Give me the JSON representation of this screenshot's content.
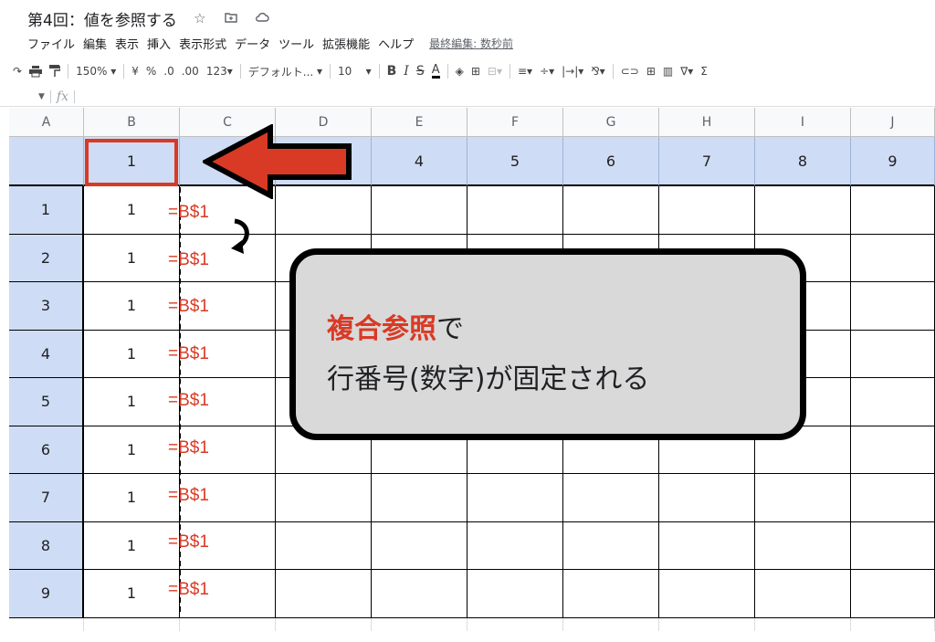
{
  "doc": {
    "title": "第4回：値を参照する",
    "icons": [
      "star-icon",
      "move-to-folder-icon",
      "cloud-status-icon"
    ]
  },
  "menu": [
    "ファイル",
    "編集",
    "表示",
    "挿入",
    "表示形式",
    "データ",
    "ツール",
    "拡張機能",
    "ヘルプ"
  ],
  "last_edit": "最終編集: 数秒前",
  "toolbar": {
    "zoom": "150%",
    "currency": "¥",
    "percent": "%",
    "dec_decrease": ".0",
    "dec_increase": ".00",
    "number_format": "123",
    "font": "デフォルト...",
    "font_size": "10",
    "bold": "B",
    "italic": "I",
    "strike": "S",
    "text_color": "A"
  },
  "formula_bar": {
    "fx": "fx",
    "content": ""
  },
  "columns": [
    "A",
    "B",
    "C",
    "D",
    "E",
    "F",
    "G",
    "H",
    "I",
    "J"
  ],
  "row1_values": [
    "",
    "1",
    "",
    "",
    "4",
    "5",
    "6",
    "7",
    "8",
    "9"
  ],
  "rows": [
    {
      "label": "1",
      "b": "1"
    },
    {
      "label": "2",
      "b": "1"
    },
    {
      "label": "3",
      "b": "1"
    },
    {
      "label": "4",
      "b": "1"
    },
    {
      "label": "5",
      "b": "1"
    },
    {
      "label": "6",
      "b": "1"
    },
    {
      "label": "7",
      "b": "1"
    },
    {
      "label": "8",
      "b": "1"
    },
    {
      "label": "9",
      "b": "1"
    }
  ],
  "formula_annotation": "=B$1",
  "callout": {
    "highlight": "複合参照",
    "line1_rest": "で",
    "line2": "行番号(数字)が固定される"
  },
  "colors": {
    "accent_red": "#d93a25",
    "header_blue": "#cfdcf5",
    "callout_bg": "#d9d9d9"
  }
}
